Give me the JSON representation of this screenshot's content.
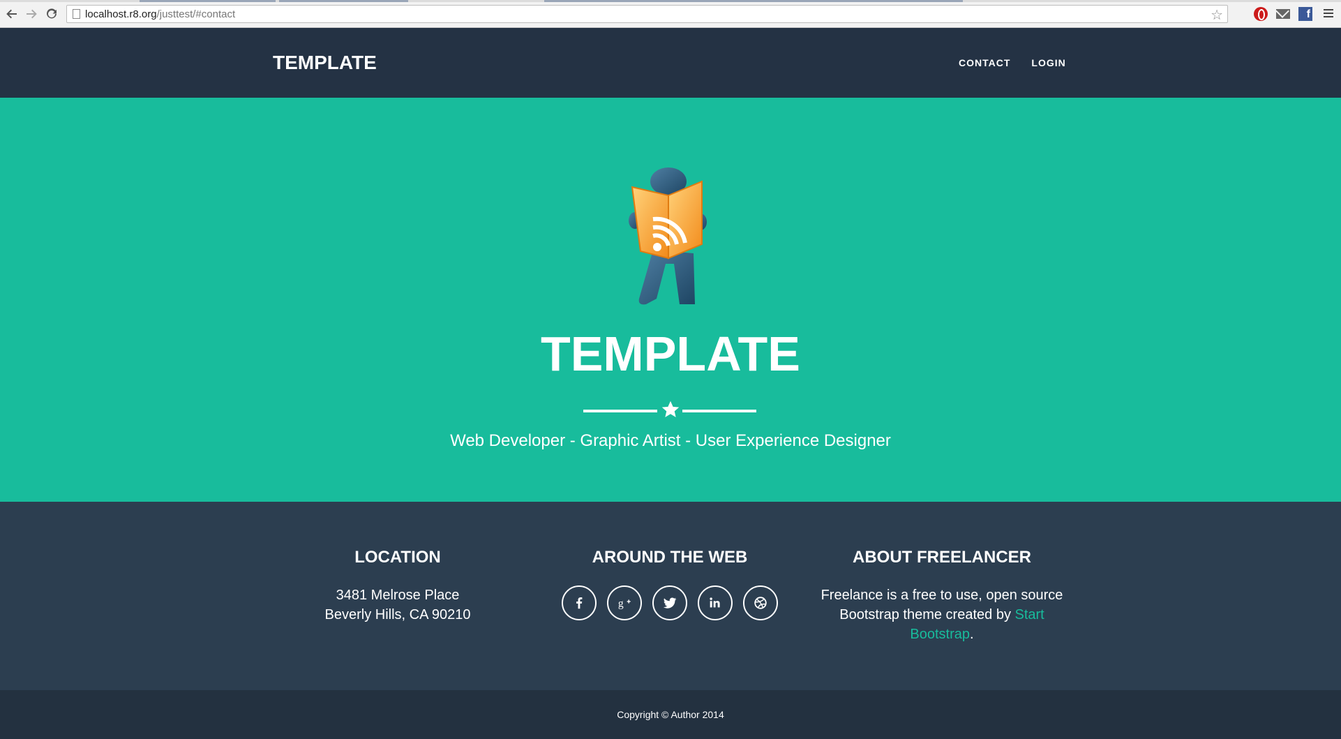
{
  "browser": {
    "url_host": "localhost.r8.org",
    "url_path": "/justtest/#contact"
  },
  "navbar": {
    "brand": "TEMPLATE",
    "links": [
      "CONTACT",
      "LOGIN"
    ]
  },
  "hero": {
    "title": "TEMPLATE",
    "subtitle": "Web Developer - Graphic Artist - User Experience Designer"
  },
  "footer": {
    "location": {
      "heading": "LOCATION",
      "line1": "3481 Melrose Place",
      "line2": "Beverly Hills, CA 90210"
    },
    "web": {
      "heading": "AROUND THE WEB",
      "icons": [
        "facebook-icon",
        "google-plus-icon",
        "twitter-icon",
        "linkedin-icon",
        "dribbble-icon"
      ]
    },
    "about": {
      "heading": "ABOUT FREELANCER",
      "text": "Freelance is a free to use, open source Bootstrap theme created by ",
      "link": "Start Bootstrap",
      "end": "."
    }
  },
  "copyright": "Copyright © Author 2014",
  "colors": {
    "accent": "#18bc9c",
    "navbar": "#243244",
    "footer": "#2c3e50"
  }
}
